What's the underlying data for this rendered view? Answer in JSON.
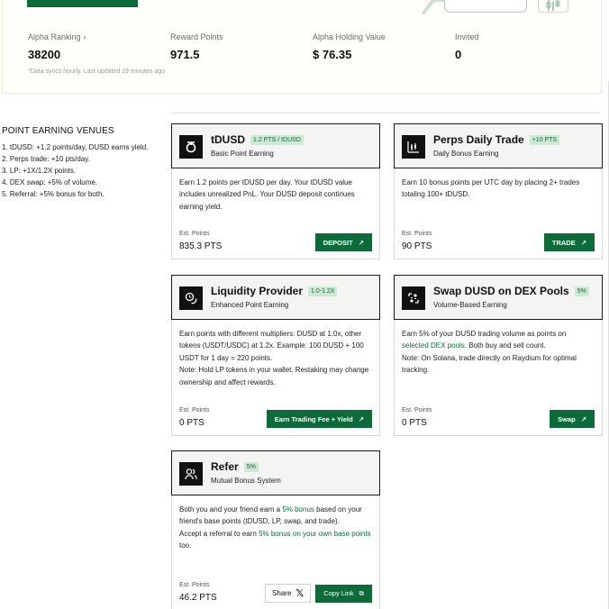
{
  "stats": [
    {
      "label": "Alpha Ranking",
      "value": "38200",
      "chevron": "chevron-right-icon"
    },
    {
      "label": "Reward Points",
      "value": "971.5"
    },
    {
      "label": "Alpha Holding Value",
      "value": "$ 76.35"
    },
    {
      "label": "Invited",
      "value": "0"
    }
  ],
  "sync_note": "*Data syncs hourly. Last updated 19 minutes ago",
  "venues": {
    "title": "POINT EARNING VENUES",
    "items": [
      "1. tDUSD: +1.2 points/day, DUSD earns yield.",
      "2. Perps trade: +10 pts/day.",
      "3. LP: +1X/1.2X points.",
      "4. DEX swap: +5% of volume.",
      "5. Referral: +5% bonus for both."
    ]
  },
  "cards": {
    "tdusd": {
      "title": "tDUSD",
      "badge": "1.2 PTS / tDUSD",
      "subtitle": "Basic Point Earning",
      "desc": "Earn 1.2 points per tDUSD per day. Your tDUSD value includes unrealized PnL. Your DUSD deposit continues earning yield.",
      "est_label": "Est. Points",
      "est_value": "835.3 PTS",
      "button": "DEPOSIT"
    },
    "perps": {
      "title": "Perps Daily Trade",
      "badge": "+10 PTS",
      "subtitle": "Daily Bonus Earning",
      "desc": "Earn 10 bonus points per UTC day by placing 2+ trades totaling 100+ tDUSD.",
      "est_label": "Est. Points",
      "est_value": "90 PTS",
      "button": "TRADE"
    },
    "lp": {
      "title": "Liquidity Provider",
      "badge": "1.0-1.2X",
      "subtitle": "Enhanced Point Earning",
      "desc": "Earn points with different multipliers: DUSD at 1.0x, other tokens (USDT/USDC) at 1.2x. Example: 100 DUSD + 100 USDT for 1 day = 220 points.",
      "note": "Note: Hold LP tokens in your wallet. Restaking may change ownership and affect rewards.",
      "est_label": "Est. Points",
      "est_value": "0 PTS",
      "button": "Earn Trading Fee + Yield"
    },
    "swap": {
      "title": "Swap DUSD on DEX Pools",
      "badge": "5%",
      "subtitle": "Volume-Based Earning",
      "desc_a": "Earn 5% of your DUSD trading volume as points on",
      "desc_link": "selected DEX pools",
      "desc_b": ". Both buy and sell count.",
      "note": "Note: On Solana, trade directly on Raydium for optimal tracking.",
      "est_label": "Est. Points",
      "est_value": "0 PTS",
      "button": "Swap"
    },
    "refer": {
      "title": "Refer",
      "badge": "5%",
      "subtitle": "Mutual Bonus System",
      "desc_a": "Both you and your friend earn a",
      "desc_hl": "5% bonus",
      "desc_b": "based on your friend's base points (tDUSD, LP, swap, and trade).",
      "desc2_a": "Accept a referral to earn",
      "desc2_hl": "5% bonus on your own base points",
      "desc2_b": "too.",
      "est_label": "Est. Points",
      "est_value": "46.2 PTS",
      "share_button": "Share",
      "copy_button": "Copy Link"
    }
  },
  "colors": {
    "accent": "#0d6b3a",
    "badge_bg": "#cfe8d6",
    "panel_border": "#f3eccb"
  }
}
